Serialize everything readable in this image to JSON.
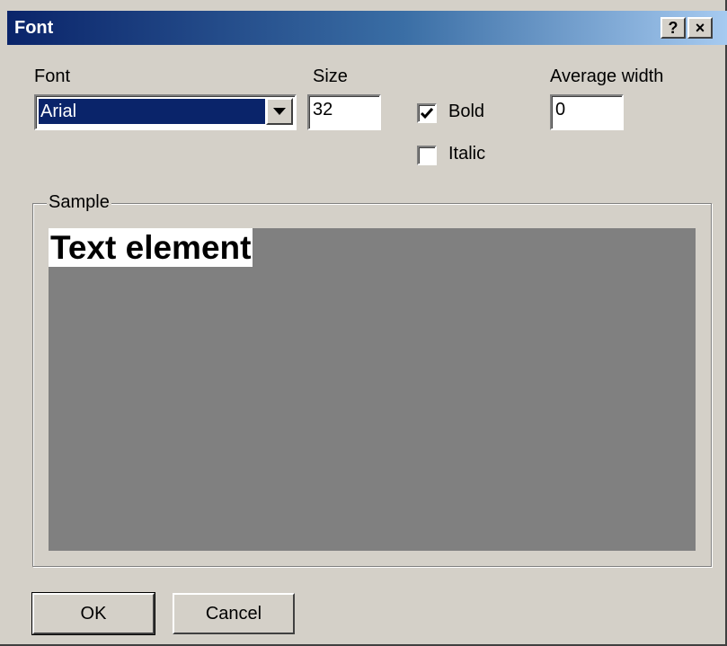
{
  "window": {
    "title": "Font",
    "help_label": "?",
    "close_label": "×"
  },
  "font": {
    "label": "Font",
    "selected": "Arial"
  },
  "size": {
    "label": "Size",
    "value": "32"
  },
  "style": {
    "bold_label": "Bold",
    "bold_checked": true,
    "italic_label": "Italic",
    "italic_checked": false
  },
  "average_width": {
    "label": "Average width",
    "value": "0"
  },
  "sample": {
    "legend": "Sample",
    "text": "Text element"
  },
  "buttons": {
    "ok": "OK",
    "cancel": "Cancel"
  },
  "colors": {
    "title_active": "#0a246a",
    "face": "#d4d0c8",
    "sample_bg": "#808080",
    "selection": "#0a246a"
  }
}
